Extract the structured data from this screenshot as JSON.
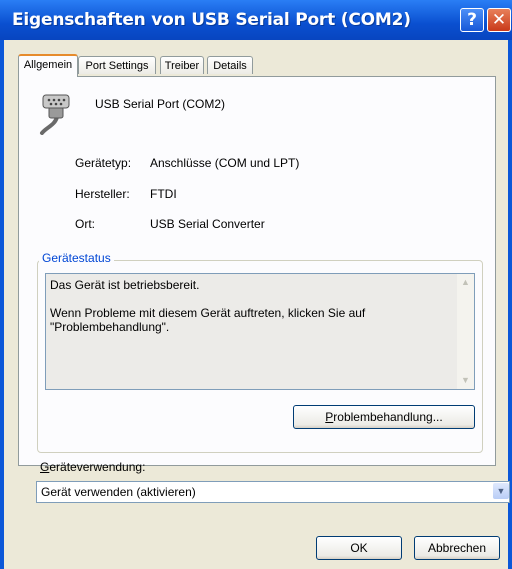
{
  "window": {
    "title": "Eigenschaften von USB Serial Port (COM2)",
    "help_glyph": "?",
    "close_glyph": "✕"
  },
  "tabs": [
    {
      "label": "Allgemein",
      "active": true
    },
    {
      "label": "Port Settings",
      "active": false
    },
    {
      "label": "Treiber",
      "active": false
    },
    {
      "label": "Details",
      "active": false
    }
  ],
  "device": {
    "name": "USB Serial Port (COM2)",
    "icon": "serial-port-icon",
    "type_label": "Gerätetyp:",
    "type_value": "Anschlüsse (COM und LPT)",
    "manufacturer_label": "Hersteller:",
    "manufacturer_value": "FTDI",
    "location_label": "Ort:",
    "location_value": "USB Serial Converter"
  },
  "status": {
    "group_title": "Gerätestatus",
    "text": "Das Gerät ist betriebsbereit.\n\nWenn Probleme mit diesem Gerät auftreten, klicken Sie auf \"Problembehandlung\".",
    "troubleshoot_prefix": "P",
    "troubleshoot_rest": "roblembehandlung..."
  },
  "usage": {
    "label_prefix": "G",
    "label_rest": "eräteverwendung:",
    "selected": "Gerät verwenden (aktivieren)"
  },
  "footer": {
    "ok_label": "OK",
    "cancel_label": "Abbrechen"
  },
  "colors": {
    "title_bar": "#0a4fd0",
    "dialog_bg": "#ece9d8",
    "group_title": "#0046d5",
    "active_tab_accent": "#e68b2c"
  }
}
